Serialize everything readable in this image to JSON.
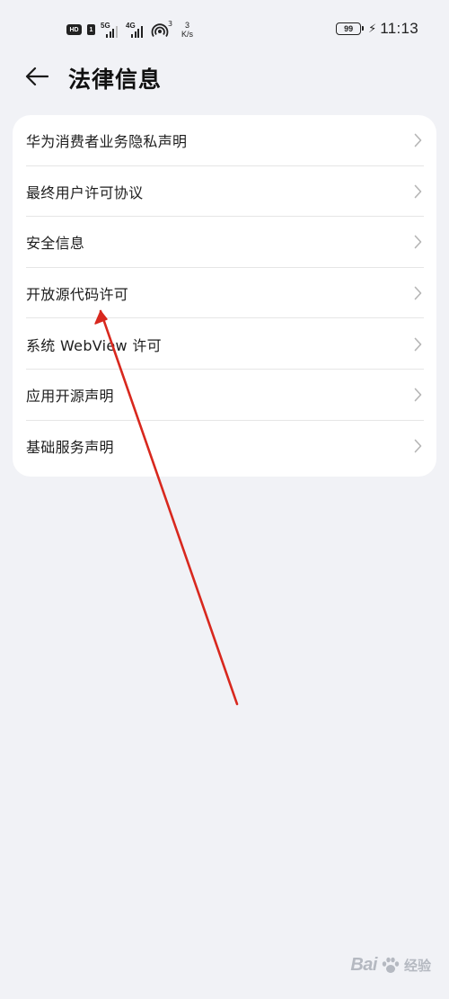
{
  "status_bar": {
    "hd_label": "HD",
    "sim_label": "1",
    "signal1_gen": "5G",
    "signal2_gen": "4G",
    "hotspot_sup": "3",
    "net_speed_value": "3",
    "net_speed_unit": "K/s",
    "battery_level": "99",
    "time": "11:13"
  },
  "header": {
    "title": "法律信息",
    "back_icon": "arrow-left-icon"
  },
  "list": {
    "items": [
      {
        "label": "华为消费者业务隐私声明"
      },
      {
        "label": "最终用户许可协议"
      },
      {
        "label": "安全信息"
      },
      {
        "label": "开放源代码许可"
      },
      {
        "label": "系统 WebView 许可"
      },
      {
        "label": "应用开源声明"
      },
      {
        "label": "基础服务声明"
      }
    ],
    "chevron_icon": "chevron-right-icon"
  },
  "annotation": {
    "color": "#d8281e",
    "type": "arrow"
  },
  "watermark": {
    "text": "Bai",
    "sub": "经验"
  },
  "colors": {
    "background": "#f1f2f6",
    "card": "#ffffff",
    "text": "#1d1d1d",
    "chevron": "#b5b5b5"
  }
}
